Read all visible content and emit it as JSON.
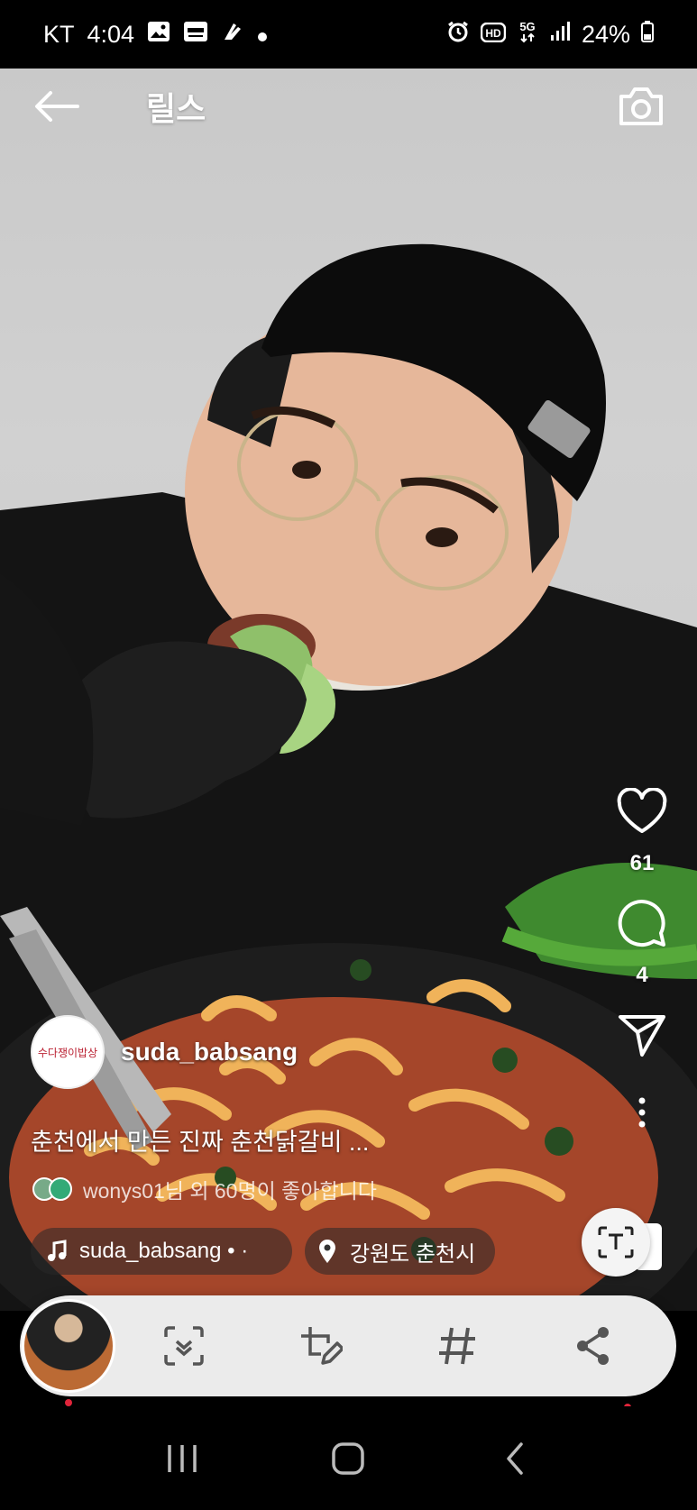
{
  "status_bar": {
    "carrier": "KT",
    "time": "4:04",
    "left_icons": [
      "gallery-icon",
      "kia-connect-icon",
      "app-icon",
      "notification-dot-icon"
    ],
    "right_icons": [
      "alarm-icon",
      "hd-voice-icon",
      "5g-icon",
      "signal-icon"
    ],
    "battery": "24%"
  },
  "header": {
    "title": "릴스",
    "back_icon": "arrow-left-icon",
    "camera_icon": "camera-icon"
  },
  "actions": {
    "like_count": "61",
    "comment_count": "4"
  },
  "post": {
    "avatar_text": "수다쟁이밥상",
    "username": "suda_babsang",
    "caption": "춘천에서 만든 진짜 춘천닭갈비 ...",
    "liked_by": "wonys01님 외 60명이 좋아합니다",
    "music_label": "suda_babsang • ·",
    "location": "강원도 춘천시"
  },
  "toolbar": {
    "buttons": [
      "scan-text-icon",
      "crop-edit-icon",
      "hashtag-icon",
      "share-icon"
    ]
  },
  "colors": {
    "accent_red": "#e0243a",
    "toolbar_bg": "#ebebeb"
  }
}
